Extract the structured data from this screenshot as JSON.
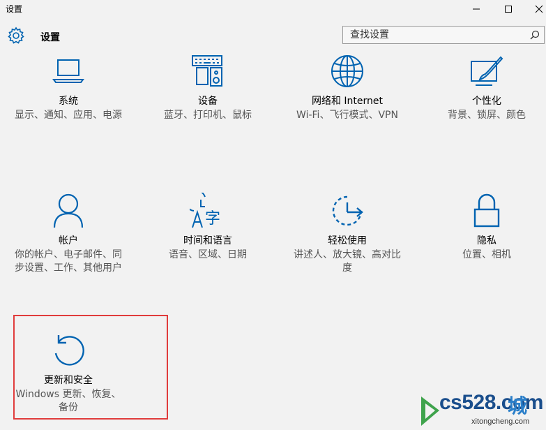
{
  "window": {
    "title": "设置"
  },
  "header": {
    "app_title": "设置",
    "gear_icon": "gear-icon",
    "search_placeholder": "查找设置"
  },
  "colors": {
    "accent": "#0063b1",
    "highlight_border": "#e03c3c",
    "background": "#f2f2f2"
  },
  "tiles": [
    {
      "id": "system",
      "icon": "laptop-icon",
      "name": "系统",
      "desc": "显示、通知、应用、电源"
    },
    {
      "id": "devices",
      "icon": "keyboard-speaker-icon",
      "name": "设备",
      "desc": "蓝牙、打印机、鼠标"
    },
    {
      "id": "network",
      "icon": "globe-icon",
      "name": "网络和 Internet",
      "desc": "Wi-Fi、飞行模式、VPN"
    },
    {
      "id": "personalization",
      "icon": "paint-brush-icon",
      "name": "个性化",
      "desc": "背景、锁屏、颜色"
    },
    {
      "id": "accounts",
      "icon": "person-icon",
      "name": "帐户",
      "desc": "你的帐户、电子邮件、同步设置、工作、其他用户"
    },
    {
      "id": "time-language",
      "icon": "clock-language-icon",
      "name": "时间和语言",
      "desc": "语音、区域、日期"
    },
    {
      "id": "ease-of-access",
      "icon": "ease-of-access-icon",
      "name": "轻松使用",
      "desc": "讲述人、放大镜、高对比度"
    },
    {
      "id": "privacy",
      "icon": "lock-icon",
      "name": "隐私",
      "desc": "位置、相机"
    },
    {
      "id": "update-security",
      "icon": "refresh-icon",
      "name": "更新和安全",
      "desc": "Windows 更新、恢复、备份"
    }
  ],
  "watermark": {
    "domain": "cs528.com",
    "cn": "城",
    "sub": "xitongcheng.com"
  }
}
